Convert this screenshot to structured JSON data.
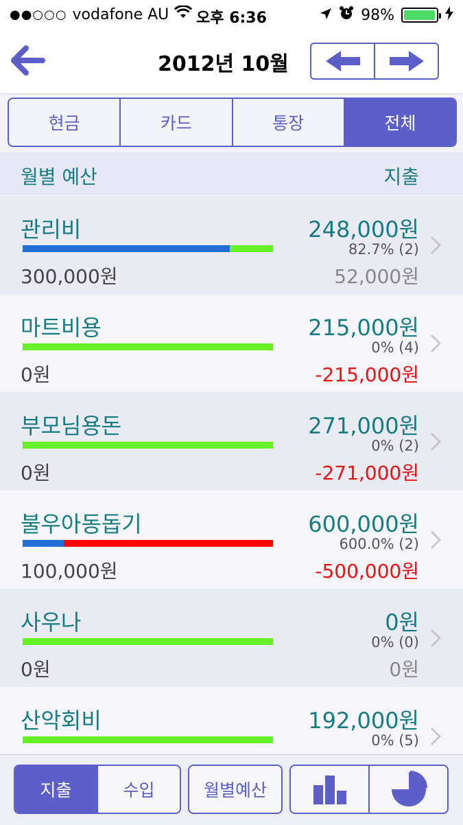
{
  "status": {
    "carrier": "vodafone AU",
    "signal": "●●○○○",
    "time": "오후 6:36",
    "battery": "98%",
    "battery_level": 0.98
  },
  "header": {
    "title": "2012년 10월"
  },
  "tabs": [
    {
      "label": "현금",
      "active": false
    },
    {
      "label": "카드",
      "active": false
    },
    {
      "label": "통장",
      "active": false
    },
    {
      "label": "전체",
      "active": true
    }
  ],
  "list_header": {
    "left": "월별 예산",
    "right": "지출"
  },
  "colors": {
    "accent": "#5b5fc7",
    "teal": "#157c84",
    "blue": "#1f6fd6",
    "green": "#66f029",
    "red": "#ff0000",
    "negative": "#ee1111"
  },
  "rows": [
    {
      "name": "관리비",
      "amount": "248,000원",
      "pct": "82.7% (2)",
      "budget": "300,000원",
      "remain": "52,000원",
      "negative": false,
      "used_fraction": 0.827,
      "over": false
    },
    {
      "name": "마트비용",
      "amount": "215,000원",
      "pct": "0% (4)",
      "budget": "0원",
      "remain": "-215,000원",
      "negative": true,
      "used_fraction": 0,
      "over": false
    },
    {
      "name": "부모님용돈",
      "amount": "271,000원",
      "pct": "0% (2)",
      "budget": "0원",
      "remain": "-271,000원",
      "negative": true,
      "used_fraction": 0,
      "over": false
    },
    {
      "name": "불우아동돕기",
      "amount": "600,000원",
      "pct": "600.0% (2)",
      "budget": "100,000원",
      "remain": "-500,000원",
      "negative": true,
      "used_fraction": 6.0,
      "over": true
    },
    {
      "name": "사우나",
      "amount": "0원",
      "pct": "0% (0)",
      "budget": "0원",
      "remain": "0원",
      "negative": false,
      "used_fraction": 0,
      "over": false
    },
    {
      "name": "산악회비",
      "amount": "192,000원",
      "pct": "0% (5)",
      "budget": "",
      "remain": "",
      "negative": false,
      "used_fraction": 0,
      "over": false
    }
  ],
  "bottom": {
    "expense": "지출",
    "income": "수입",
    "monthly_budget": "월별예산",
    "active": "expense"
  }
}
